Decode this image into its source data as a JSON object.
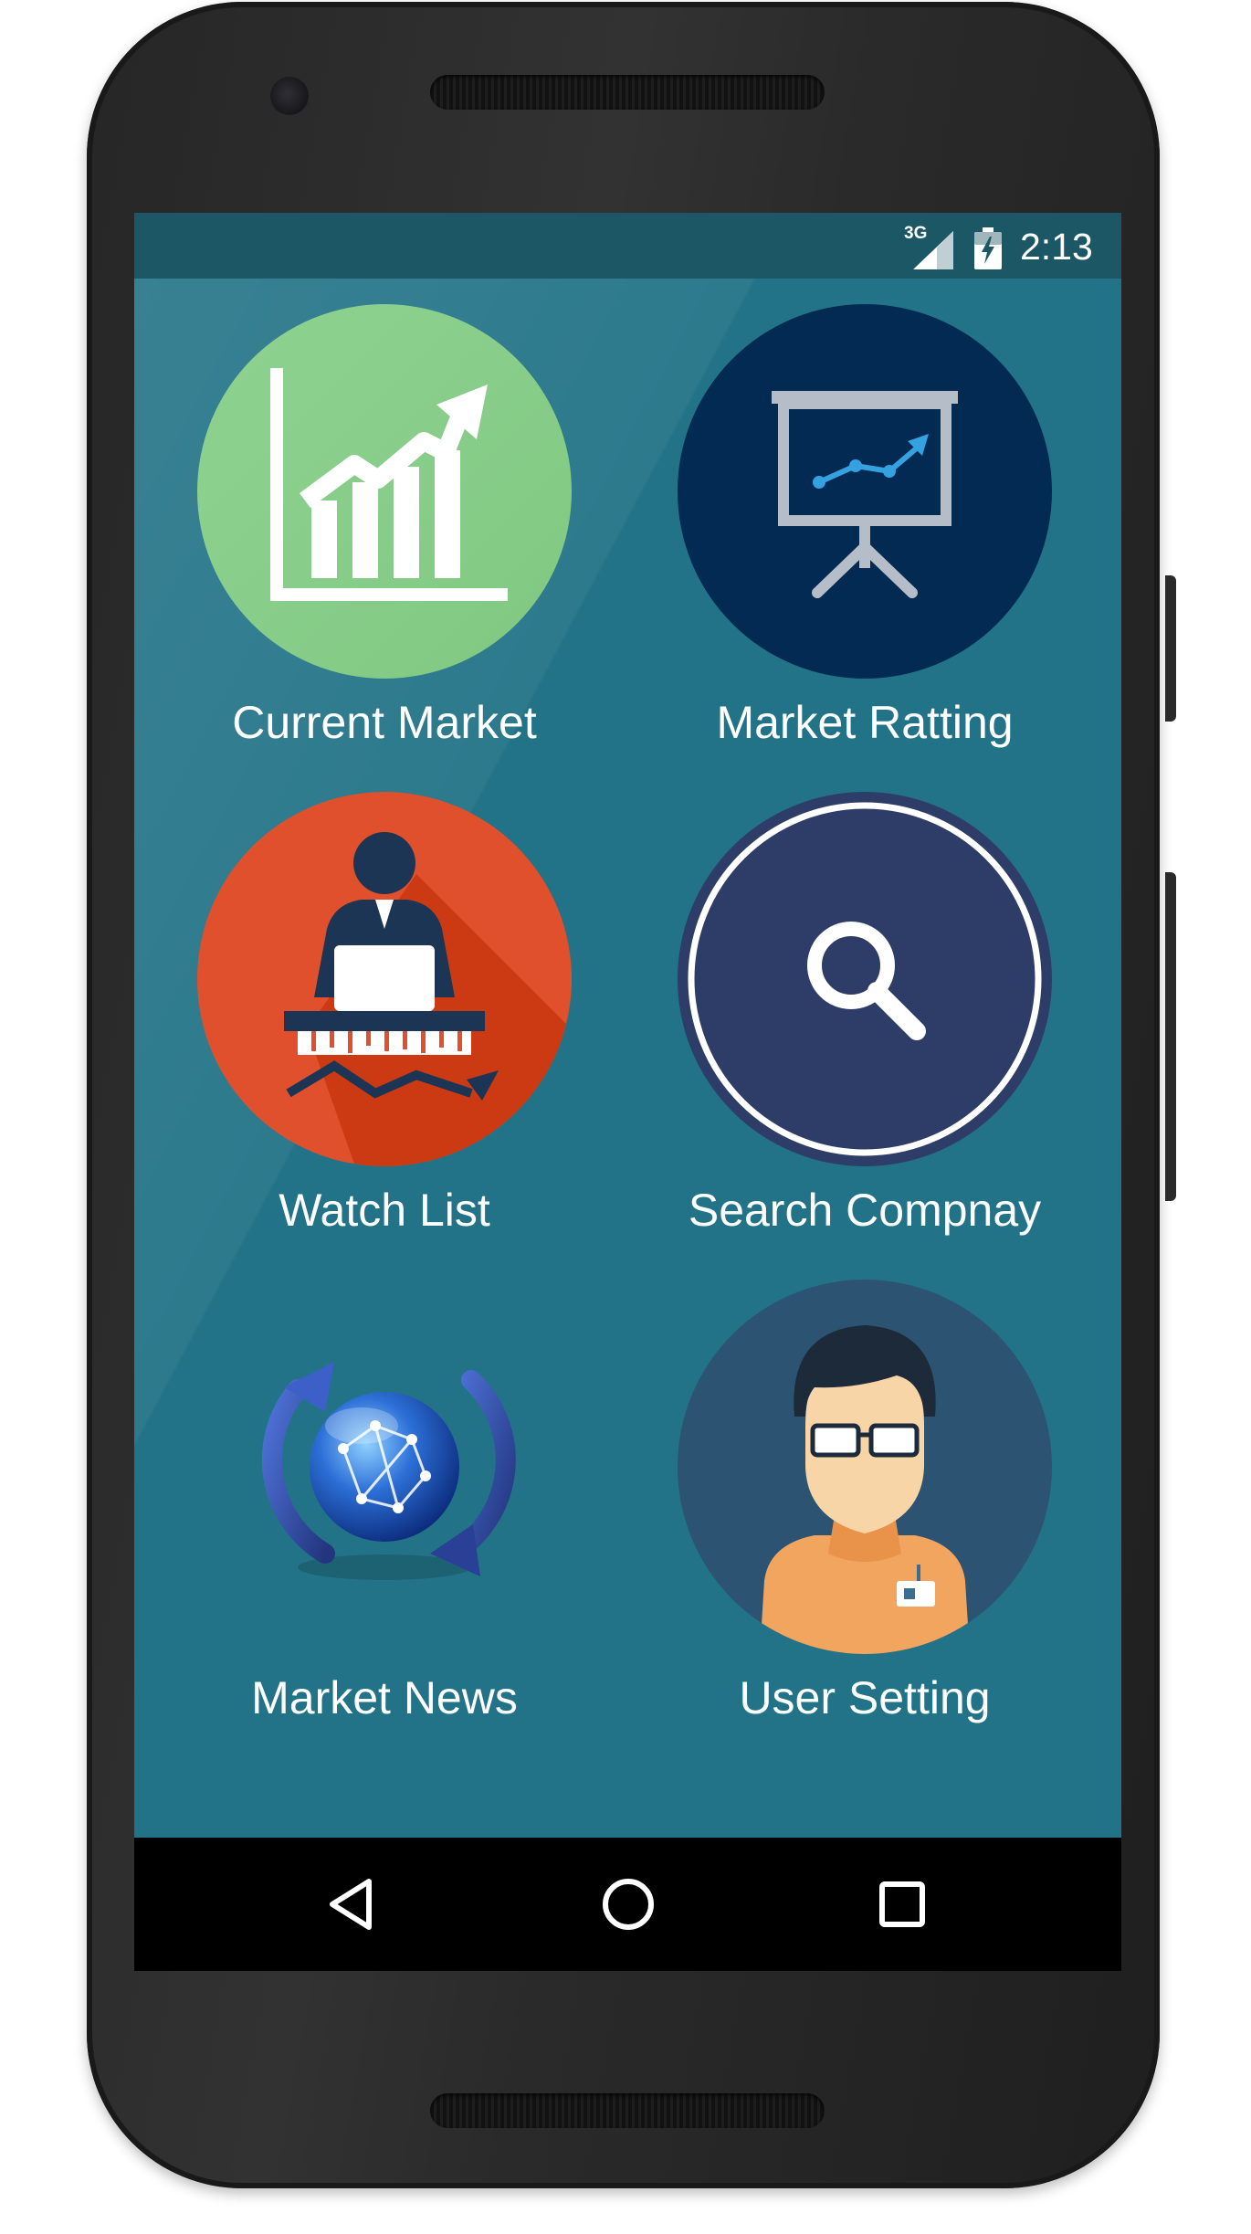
{
  "status_bar": {
    "network_type": "3G",
    "time": "2:13",
    "icons": [
      "signal-icon",
      "battery-charging-icon"
    ]
  },
  "menu": {
    "items": [
      {
        "id": "current-market",
        "label": "Current Market",
        "icon": "growth-chart-icon",
        "color": "#8dd08f"
      },
      {
        "id": "market-ratting",
        "label": "Market Ratting",
        "icon": "presentation-board-icon",
        "color": "#022a52"
      },
      {
        "id": "watch-list",
        "label": "Watch List",
        "icon": "trader-desk-icon",
        "color": "#e1502c"
      },
      {
        "id": "search-company",
        "label": "Search Compnay",
        "icon": "magnifier-icon",
        "color": "#2f3f69"
      },
      {
        "id": "market-news",
        "label": "Market News",
        "icon": "globe-refresh-icon",
        "color": "#2b58b6"
      },
      {
        "id": "user-setting",
        "label": "User Setting",
        "icon": "user-avatar-icon",
        "color": "#2c5372"
      }
    ]
  },
  "navigation": {
    "buttons": [
      "back-icon",
      "home-icon",
      "recents-icon"
    ]
  },
  "colors": {
    "screen_background": "#227387",
    "status_bar": "#1c5766",
    "nav_bar": "#000000",
    "label_text": "#ffffff"
  }
}
